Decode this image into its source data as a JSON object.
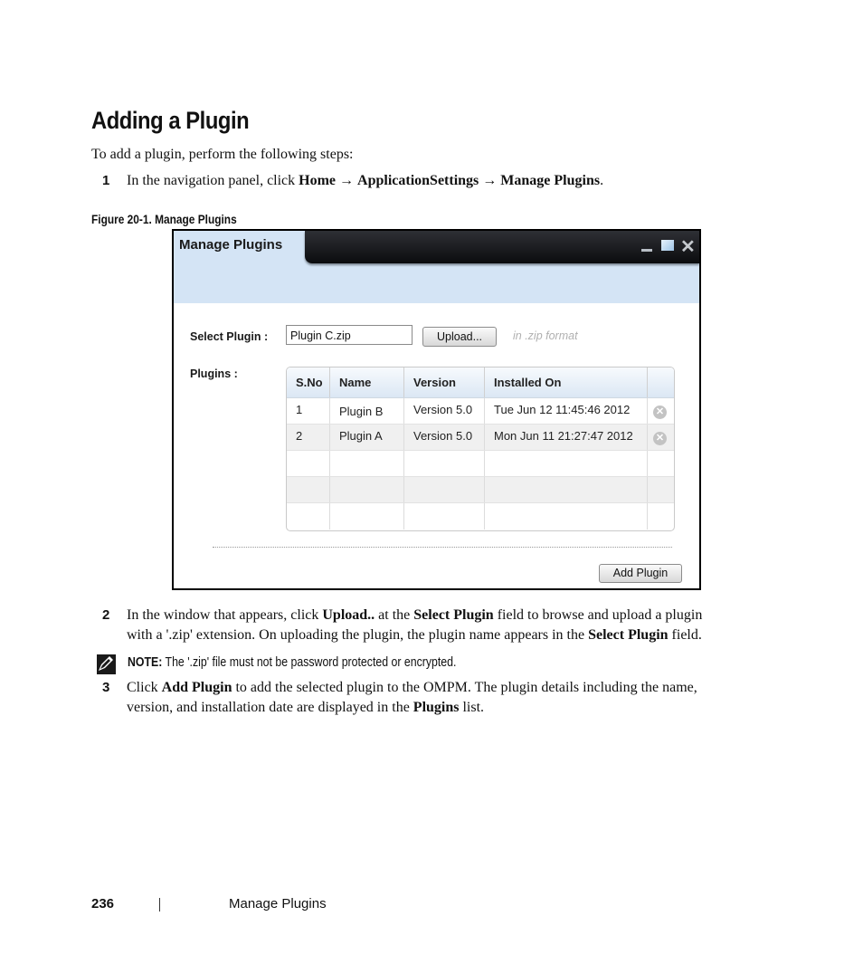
{
  "page": {
    "heading": "Adding a Plugin",
    "intro": "To add a plugin, perform the following steps:",
    "steps": [
      {
        "number": "1",
        "parts": [
          "In the navigation panel, click ",
          "Home",
          " → ",
          "ApplicationSettings",
          " → ",
          "Manage Plugins",
          "."
        ]
      },
      {
        "number": "2",
        "line1": [
          "In the window that appears, click ",
          "Upload..",
          " at the ",
          "Select Plugin",
          " field to browse and upload a plugin"
        ],
        "line2": [
          "with a '.zip' extension. On uploading the plugin, the plugin name appears in the ",
          "Select Plugin",
          " field."
        ]
      },
      {
        "number": "3",
        "line1": [
          "Click ",
          "Add Plugin",
          " to add the selected plugin to the OMPM. The plugin details including the name,"
        ],
        "line2": [
          "version, and installation date are displayed in the ",
          "Plugins",
          " list."
        ]
      }
    ],
    "figure_caption": "Figure 20-1.    Manage Plugins",
    "note": {
      "icon": "pencil-note-icon",
      "label": "NOTE:",
      "text": " The '.zip' file must not be password protected or encrypted."
    },
    "footer": {
      "page_number": "236",
      "section": "Manage Plugins"
    }
  },
  "window": {
    "title": "Manage Plugins",
    "controls": {
      "minimize": "minimize-icon",
      "maximize": "maximize-icon",
      "close": "✕"
    },
    "select_plugin_label": "Select Plugin :",
    "select_plugin_value": "Plugin C.zip",
    "upload_button": "Upload...",
    "format_hint": "in .zip format",
    "plugins_label": "Plugins :",
    "table": {
      "columns": [
        "S.No",
        "Name",
        "Version",
        "Installed On",
        ""
      ],
      "rows": [
        {
          "sno": "1",
          "name": "Plugin B",
          "version": "Version 5.0",
          "installed_on": "Tue Jun 12 11:45:46 2012",
          "action": "✕"
        },
        {
          "sno": "2",
          "name": "Plugin A",
          "version": "Version 5.0",
          "installed_on": "Mon Jun 11 21:27:47 2012",
          "action": "✕"
        }
      ],
      "empty_rows": 3
    },
    "add_button": "Add Plugin"
  }
}
